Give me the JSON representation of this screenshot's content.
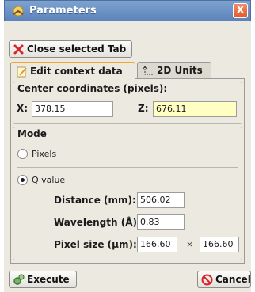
{
  "window": {
    "title": "Parameters",
    "close_glyph": "X"
  },
  "toolbar": {
    "close_tab_label": "Close selected Tab"
  },
  "tabs": [
    {
      "label": "Edit context data",
      "active": true
    },
    {
      "label": "2D Units",
      "active": false
    }
  ],
  "center": {
    "title": "Center coordinates (pixels):",
    "x_label": "X:",
    "x_value": "378.15",
    "z_label": "Z:",
    "z_value": "676.11"
  },
  "mode": {
    "title": "Mode",
    "pixels_label": "Pixels",
    "q_label": "Q value",
    "selected": "Q value",
    "distance_label": "Distance (mm):",
    "distance_value": "506.02",
    "wavelength_label": "Wavelength (Å):",
    "wavelength_value": "0.83",
    "pixel_size_label": "Pixel size (µm):",
    "pixel_size_x": "166.60",
    "times_glyph": "×",
    "pixel_size_y": "166.60"
  },
  "footer": {
    "execute_label": "Execute",
    "cancel_label": "Cancel"
  },
  "colors": {
    "title_bar": "#6e93c6",
    "close_button": "#e8673a",
    "highlight_field": "#ffffc4"
  }
}
